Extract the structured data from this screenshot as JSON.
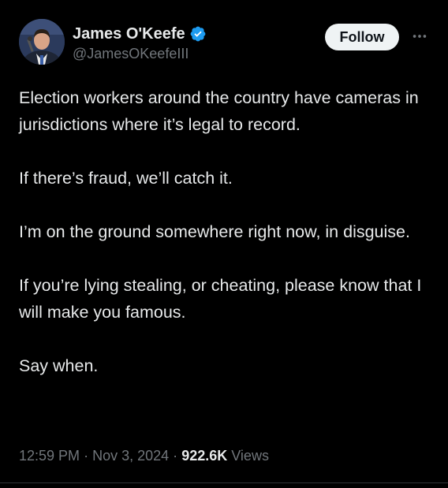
{
  "author": {
    "display_name": "James O'Keefe",
    "handle": "@JamesOKeefeIII",
    "verified": true,
    "avatar_icon": "profile-photo"
  },
  "actions": {
    "follow_label": "Follow",
    "more_icon": "more-horizontal-icon"
  },
  "tweet": {
    "paragraphs": [
      "Election workers around the country have cameras in jurisdictions where it’s legal to record.",
      "If there’s fraud, we’ll catch it.",
      "I’m on the ground somewhere right now, in disguise.",
      "If you’re lying stealing, or cheating, please know that I will make you famous.",
      "Say when."
    ]
  },
  "meta": {
    "time": "12:59 PM",
    "separator": "·",
    "date": "Nov 3, 2024",
    "views_count": "922.6K",
    "views_label": "Views"
  },
  "colors": {
    "background": "#000000",
    "text": "#e7e9ea",
    "secondary_text": "#71767b",
    "verified_badge": "#1d9bf0",
    "follow_button_bg": "#eff3f4"
  }
}
